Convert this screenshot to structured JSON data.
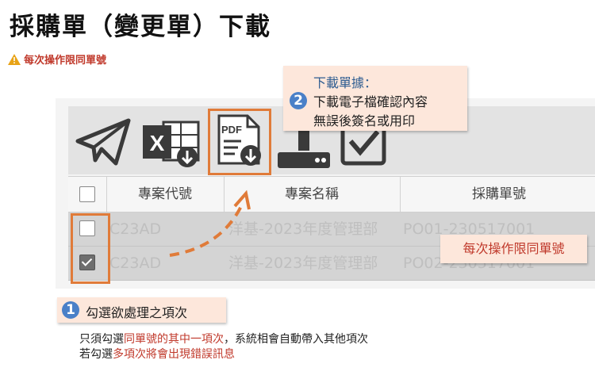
{
  "title": "採購單（變更單）下載",
  "warning": "每次操作限同單號",
  "toolbar": {
    "icons": [
      "send-icon",
      "excel-export-icon",
      "pdf-download-icon",
      "upload-icon",
      "check-icon"
    ]
  },
  "table": {
    "headers": [
      "專案代號",
      "專案名稱",
      "採購單號"
    ],
    "rows": [
      {
        "code": "C23AD",
        "name": "洋基-2023年度管理部",
        "po": "PO01-230517001",
        "checked": false
      },
      {
        "code": "C23AD",
        "name": "洋基-2023年度管理部",
        "po": "PO02-230517001",
        "checked": true
      }
    ]
  },
  "callout_download": {
    "badge": "2",
    "heading": "下載單據：",
    "line1": "下載電子檔確認內容",
    "line2": "無誤後簽名或用印"
  },
  "callout_same_po": "每次操作限同單號",
  "callout_select": {
    "badge": "1",
    "label": "勾選欲處理之項次"
  },
  "notes": {
    "l1_pre": "只須勾選",
    "l1_red": "同單號的其中一項次",
    "l1_post": "，系統相會自動帶入其他項次",
    "l2_pre": "若勾選",
    "l2_red": "多項次將會出現錯誤訊息"
  },
  "colors": {
    "highlight": "#e07b39",
    "callout_bg": "#fde7db",
    "badge": "#4a80c8",
    "warning_red": "#c0392b"
  }
}
